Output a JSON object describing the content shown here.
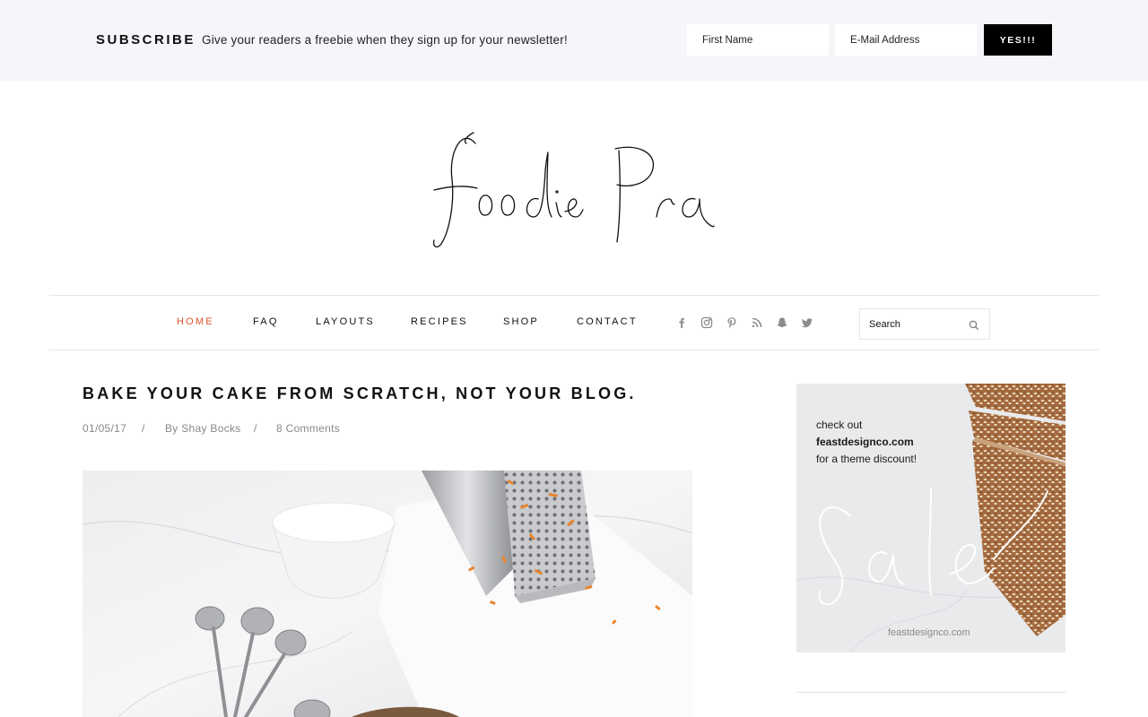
{
  "subscribe": {
    "heading": "SUBSCRIBE",
    "text": "Give your readers a freebie when they sign up for your newsletter!",
    "first_name_placeholder": "First Name",
    "email_placeholder": "E-Mail Address",
    "button_label": "YES!!!"
  },
  "logo": {
    "text": "Foodie Pro"
  },
  "nav": {
    "items": [
      {
        "label": "HOME",
        "active": true
      },
      {
        "label": "FAQ"
      },
      {
        "label": "LAYOUTS"
      },
      {
        "label": "RECIPES"
      },
      {
        "label": "SHOP"
      },
      {
        "label": "CONTACT"
      }
    ],
    "social_icons": [
      "facebook-icon",
      "instagram-icon",
      "pinterest-icon",
      "rss-icon",
      "snapchat-icon",
      "twitter-icon"
    ],
    "search_placeholder": "Search"
  },
  "post": {
    "title": "BAKE YOUR CAKE FROM SCRATCH, NOT YOUR BLOG.",
    "date": "01/05/17",
    "separator": "/",
    "author": "By Shay Bocks",
    "comments": "8 Comments"
  },
  "sidebar": {
    "ad": {
      "line1": "check out",
      "line2": "feastdesignco.com",
      "line3": "for a theme discount!",
      "script_text": "Sale",
      "footer": "feastdesignco.com"
    }
  },
  "colors": {
    "accent": "#e2522d",
    "subscribe_bg": "#f5f6fa",
    "button_bg": "#000000"
  }
}
